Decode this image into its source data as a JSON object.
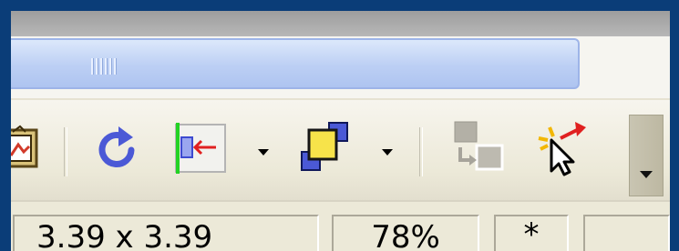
{
  "toolbar": {
    "items": [
      {
        "name": "image-frame-icon"
      },
      {
        "name": "rotate-icon"
      },
      {
        "name": "crop-to-margin-icon"
      },
      {
        "name": "arrange-objects-icon"
      },
      {
        "name": "ungroup-objects-icon"
      },
      {
        "name": "pointer-select-icon"
      }
    ]
  },
  "status": {
    "size": "3.39 x 3.39",
    "zoom": "78%",
    "modified": "*",
    "blank": ""
  },
  "colors": {
    "frame": "#0a3d78",
    "scroll_track": "#bccff4",
    "icon_blue": "#4b59d6",
    "icon_yellow": "#f7e34a",
    "icon_red": "#e02020",
    "icon_green": "#23d323",
    "disabled_grey": "#a7a49b"
  }
}
